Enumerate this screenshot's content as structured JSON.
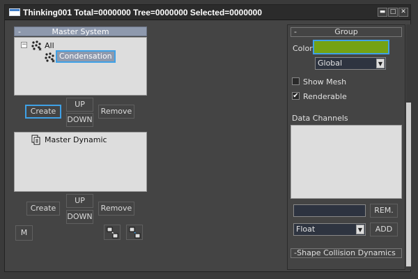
{
  "window": {
    "title": "Thinking001  Total=0000000  Tree=0000000  Selected=0000000",
    "minimize_glyph": "▬",
    "maximize_glyph": "□",
    "close_glyph": "✕"
  },
  "master_system": {
    "header": "Master System",
    "collapse_glyph": "-",
    "tree": [
      {
        "label": "All",
        "expander": "−",
        "icon": "particle-group-icon"
      },
      {
        "label": "Condensation",
        "icon": "particle-group-icon",
        "selected": true
      }
    ],
    "create_label": "Create",
    "up_label": "UP",
    "down_label": "DOWN",
    "remove_label": "Remove"
  },
  "dynamics_list": {
    "items": [
      {
        "label": "Master Dynamic",
        "icon": "dynamic-icon"
      }
    ],
    "create_label": "Create",
    "up_label": "UP",
    "down_label": "DOWN",
    "remove_label": "Remove",
    "m_label": "M",
    "copy_icon": "copy-dynamic-icon",
    "paste_icon": "paste-dynamic-icon"
  },
  "group_panel": {
    "header": "Group",
    "collapse_glyph": "-",
    "color_label": "Color",
    "color_value": "#74a213",
    "scope_value": "Global",
    "show_mesh_label": "Show Mesh",
    "show_mesh_checked": false,
    "renderable_label": "Renderable",
    "renderable_checked": true,
    "data_channels_label": "Data Channels",
    "rem_label": "REM.",
    "type_value": "Float",
    "add_label": "ADD",
    "check_glyph": "✔"
  },
  "shape_panel": {
    "header": "Shape Collision Dynamics",
    "collapse_glyph": "-"
  },
  "accent_color": "#3fa1e6"
}
